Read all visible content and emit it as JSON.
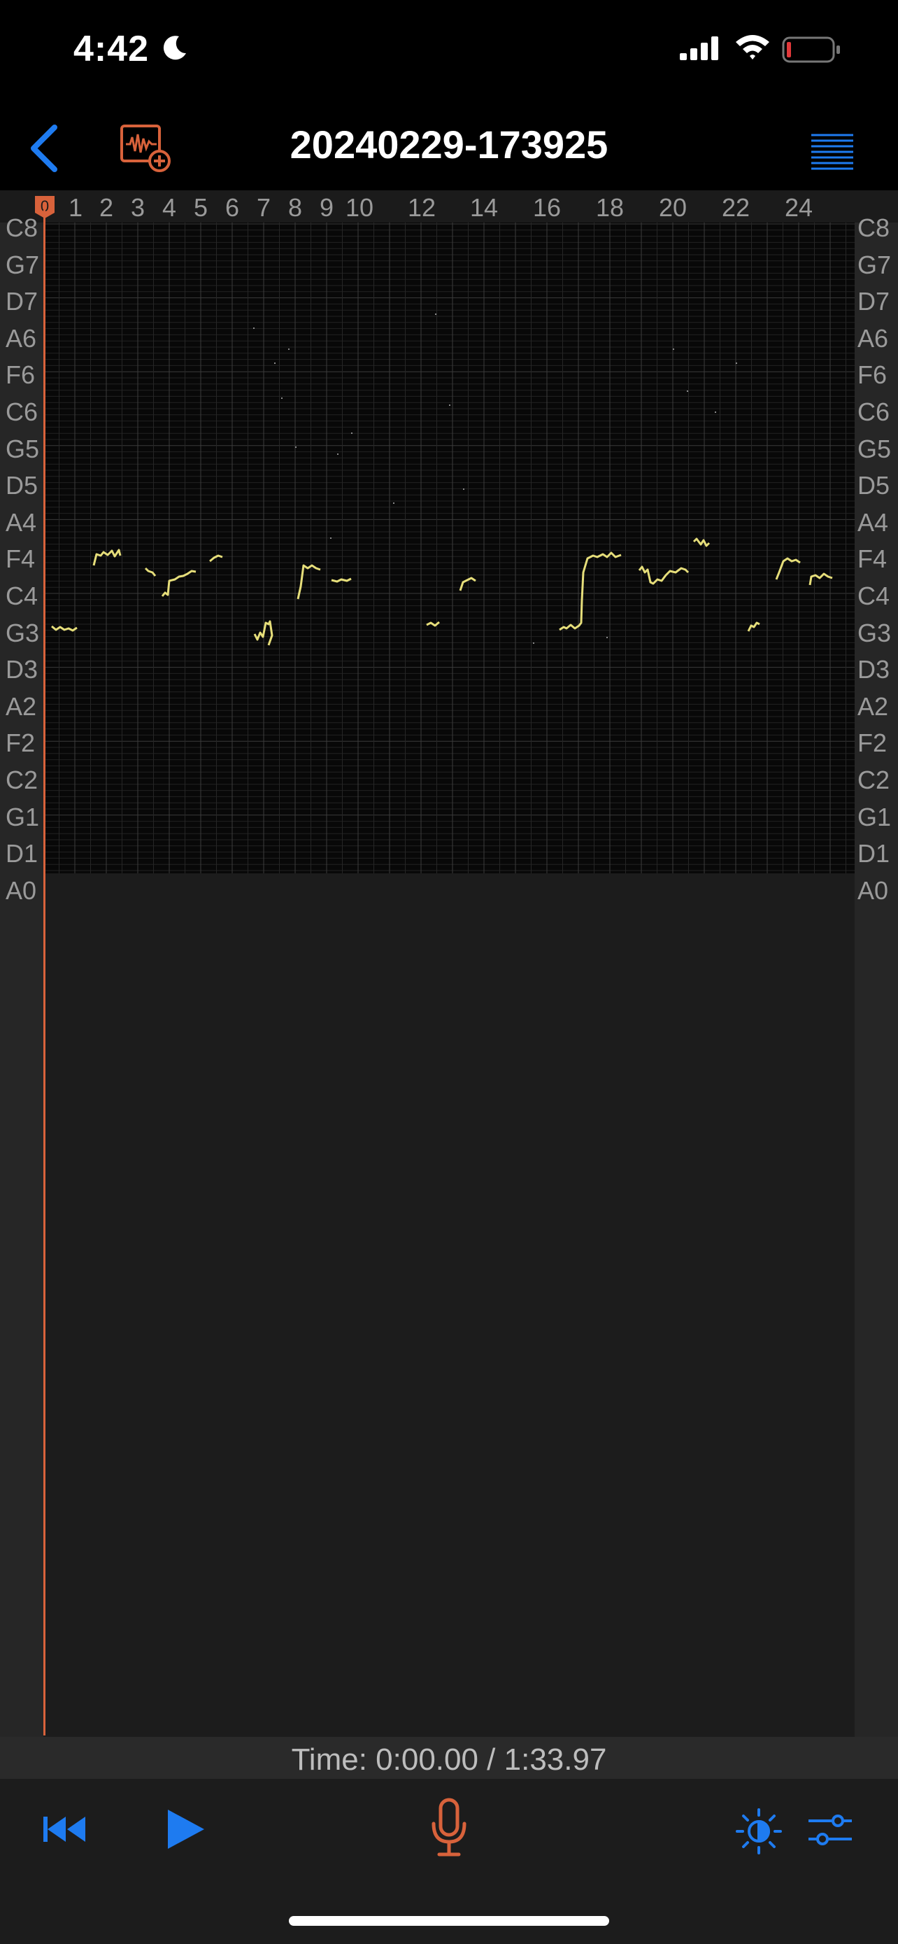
{
  "status": {
    "time": "4:42",
    "icons": [
      "moon-icon",
      "cellular-signal-icon",
      "wifi-icon",
      "battery-low-icon"
    ]
  },
  "nav": {
    "title": "20240229-173925",
    "back_icon": "chevron-left-icon",
    "add_icon": "add-audio-icon",
    "menu_icon": "menu-lines-icon"
  },
  "ruler": {
    "playhead_label": "0",
    "labels": [
      "1",
      "2",
      "3",
      "4",
      "5",
      "6",
      "7",
      "8",
      "9",
      "10",
      "12",
      "14",
      "16",
      "18",
      "20",
      "22",
      "24"
    ]
  },
  "notes": [
    "C8",
    "G7",
    "D7",
    "A6",
    "F6",
    "C6",
    "G5",
    "D5",
    "A4",
    "F4",
    "C4",
    "G3",
    "D3",
    "A2",
    "F2",
    "C2",
    "G1",
    "D1",
    "A0"
  ],
  "playback": {
    "time_label": "Time:",
    "current": "0:00.00",
    "total": "1:33.97",
    "time_text": "Time: 0:00.00 / 1:33.97"
  },
  "toolbar": {
    "icons": [
      "rewind-icon",
      "play-icon",
      "microphone-icon",
      "brightness-icon",
      "sliders-icon"
    ]
  },
  "colors": {
    "accent_blue": "#1e7bf0",
    "record_red": "#d8623b",
    "pitch_trace": "#e6de7a"
  }
}
